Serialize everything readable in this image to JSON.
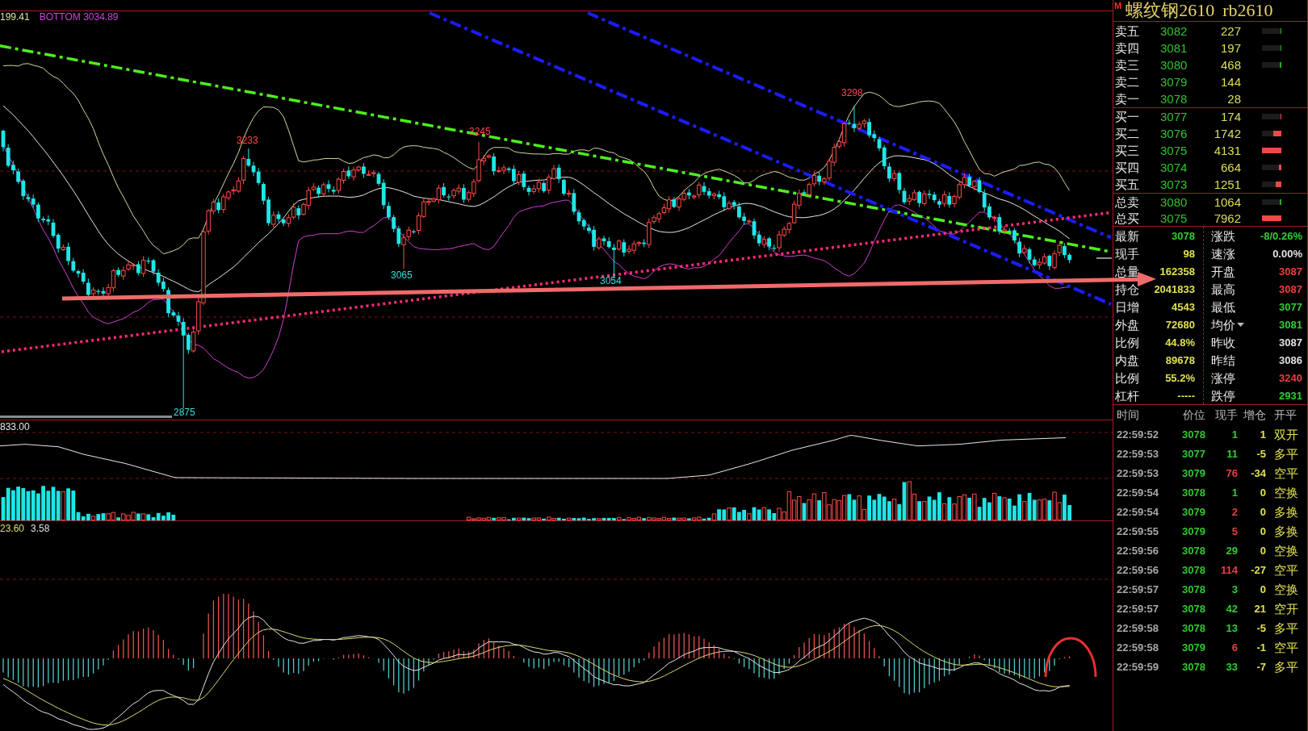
{
  "main_chart": {
    "band_labels": [
      {
        "text": "199.41",
        "color": "#e0e0a0"
      },
      {
        "text": "BOTTOM 3034.89",
        "color": "#d040e0"
      }
    ],
    "price_marks": [
      {
        "text": "3233",
        "kind": "high"
      },
      {
        "text": "3245",
        "kind": "high"
      },
      {
        "text": "3298",
        "kind": "high"
      },
      {
        "text": "3065",
        "kind": "low"
      },
      {
        "text": "3054",
        "kind": "low"
      },
      {
        "text": "2875",
        "kind": "low"
      }
    ]
  },
  "volume_panel": {
    "label": "833.00"
  },
  "macd_panel": {
    "labels": [
      {
        "text": "23.60",
        "color": "#e0e060"
      },
      {
        "text": "3.58",
        "color": "#e0e0e0"
      }
    ]
  },
  "quote_panel": {
    "badge": "M",
    "name": "螺纹钢2610",
    "code": "rb2610",
    "order_book": {
      "asks": [
        {
          "label": "卖五",
          "price": "3082",
          "volume": "227",
          "level": 0.04
        },
        {
          "label": "卖四",
          "price": "3081",
          "volume": "197",
          "level": 0.04
        },
        {
          "label": "卖三",
          "price": "3080",
          "volume": "468",
          "level": 0.08
        },
        {
          "label": "卖二",
          "price": "3079",
          "volume": "144"
        },
        {
          "label": "卖一",
          "price": "3078",
          "volume": "28"
        }
      ],
      "bids": [
        {
          "label": "买一",
          "price": "3077",
          "volume": "174",
          "level": 0.04
        },
        {
          "label": "买二",
          "price": "3076",
          "volume": "1742",
          "level": 0.42
        },
        {
          "label": "买三",
          "price": "3075",
          "volume": "4131",
          "level": 1
        },
        {
          "label": "买四",
          "price": "3074",
          "volume": "664",
          "level": 0.12
        },
        {
          "label": "买五",
          "price": "3073",
          "volume": "1251",
          "level": 0.29
        }
      ],
      "totals": [
        {
          "label": "总卖",
          "price": "3080",
          "volume": "1064",
          "level": 0.1,
          "kind": "sell"
        },
        {
          "label": "总买",
          "price": "3075",
          "volume": "7962",
          "level": 1,
          "kind": "buy"
        }
      ]
    },
    "stats": {
      "left": [
        {
          "label": "最新",
          "value": "3078",
          "color": "#33cc33",
          "dropdown": false
        },
        {
          "label": "现手",
          "value": "98",
          "color": "#e0e050",
          "dropdown": false
        },
        {
          "label": "总量",
          "value": "162358",
          "color": "#e0e050",
          "dropdown": false
        },
        {
          "label": "持仓",
          "value": "2041833",
          "color": "#e0e050",
          "dropdown": false
        },
        {
          "label": "日增",
          "value": "4543",
          "color": "#e0e050",
          "dropdown": false
        },
        {
          "label": "外盘",
          "value": "72680",
          "color": "#e0e050",
          "dropdown": false
        },
        {
          "label": "比例",
          "value": "44.8%",
          "color": "#e0e050",
          "dropdown": false
        },
        {
          "label": "内盘",
          "value": "89678",
          "color": "#e0e050",
          "dropdown": false
        },
        {
          "label": "比例",
          "value": "55.2%",
          "color": "#e0e050",
          "dropdown": false
        },
        {
          "label": "杠杆",
          "value": "-----",
          "color": "#e0e050",
          "dropdown": false
        }
      ],
      "right": [
        {
          "label": "涨跌",
          "value": "-8/0.26%",
          "color": "#33cc33",
          "dropdown": false
        },
        {
          "label": "速涨",
          "value": "0.00%",
          "color": "#e0e0e0",
          "dropdown": false
        },
        {
          "label": "开盘",
          "value": "3087",
          "color": "#e84040",
          "dropdown": false
        },
        {
          "label": "最高",
          "value": "3087",
          "color": "#e84040",
          "dropdown": false
        },
        {
          "label": "最低",
          "value": "3077",
          "color": "#33cc33",
          "dropdown": false
        },
        {
          "label": "均价",
          "value": "3081",
          "color": "#33cc33",
          "dropdown": true
        },
        {
          "label": "昨收",
          "value": "3087",
          "color": "#e0e0e0",
          "dropdown": false
        },
        {
          "label": "昨结",
          "value": "3086",
          "color": "#e0e0e0",
          "dropdown": false
        },
        {
          "label": "涨停",
          "value": "3240",
          "color": "#e84040",
          "dropdown": false
        },
        {
          "label": "跌停",
          "value": "2931",
          "color": "#33cc33",
          "dropdown": false
        }
      ]
    },
    "trades": {
      "columns": [
        "时间",
        "价位",
        "现手",
        "增仓",
        "开平"
      ],
      "rows": [
        {
          "time": "22:59:52",
          "price": "3078",
          "volume": "1",
          "color": "#33cc33",
          "change": "1",
          "action": "双开"
        },
        {
          "time": "22:59:53",
          "price": "3077",
          "volume": "11",
          "color": "#33cc33",
          "change": "-5",
          "action": "多平"
        },
        {
          "time": "22:59:53",
          "price": "3079",
          "volume": "76",
          "color": "#e84040",
          "change": "-34",
          "action": "空平"
        },
        {
          "time": "22:59:54",
          "price": "3078",
          "volume": "1",
          "color": "#33cc33",
          "change": "0",
          "action": "空换"
        },
        {
          "time": "22:59:54",
          "price": "3079",
          "volume": "2",
          "color": "#e84040",
          "change": "0",
          "action": "多换"
        },
        {
          "time": "22:59:55",
          "price": "3079",
          "volume": "5",
          "color": "#e84040",
          "change": "0",
          "action": "多换"
        },
        {
          "time": "22:59:56",
          "price": "3078",
          "volume": "29",
          "color": "#33cc33",
          "change": "0",
          "action": "空换"
        },
        {
          "time": "22:59:56",
          "price": "3078",
          "volume": "114",
          "color": "#e84040",
          "change": "-27",
          "action": "空平"
        },
        {
          "time": "22:59:57",
          "price": "3078",
          "volume": "3",
          "color": "#33cc33",
          "change": "0",
          "action": "空换"
        },
        {
          "time": "22:59:57",
          "price": "3078",
          "volume": "42",
          "color": "#33cc33",
          "change": "21",
          "action": "空开"
        },
        {
          "time": "22:59:58",
          "price": "3078",
          "volume": "13",
          "color": "#33cc33",
          "change": "-5",
          "action": "多平"
        },
        {
          "time": "22:59:58",
          "price": "3079",
          "volume": "6",
          "color": "#e84040",
          "change": "-1",
          "action": "空平"
        },
        {
          "time": "22:59:59",
          "price": "3078",
          "volume": "33",
          "color": "#33cc33",
          "change": "-7",
          "action": "多平"
        }
      ]
    }
  }
}
